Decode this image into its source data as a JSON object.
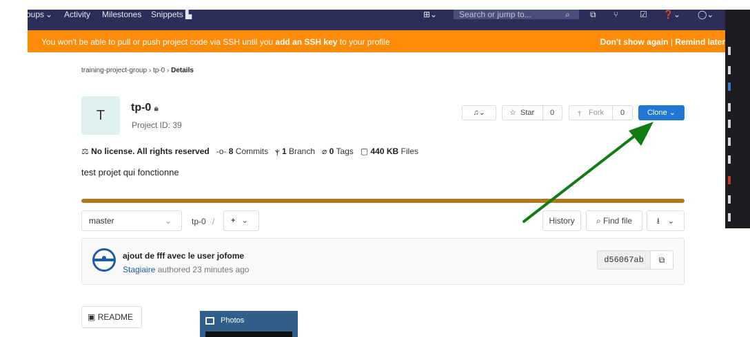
{
  "navbar": {
    "items": [
      "oups",
      "Activity",
      "Milestones",
      "Snippets"
    ],
    "search_placeholder": "Search or jump to..."
  },
  "alert": {
    "message_pre": "You won't be able to pull or push project code via SSH until you ",
    "message_bold": "add an SSH key",
    "message_post": " to your profile",
    "dont_show": "Don't show again",
    "separator": "|",
    "remind_later": "Remind later"
  },
  "breadcrumb": {
    "group": "training-project-group",
    "project": "tp-0",
    "current": "Details",
    "separator": "›"
  },
  "project": {
    "avatar_letter": "T",
    "name": "tp-0",
    "id_label": "Project ID: 39",
    "description": "test projet qui fonctionne"
  },
  "actions": {
    "star_label": "Star",
    "star_count": "0",
    "fork_label": "Fork",
    "fork_count": "0",
    "clone_label": "Clone"
  },
  "stats": {
    "license": "No license. All rights reserved",
    "commits_count": "8",
    "commits_label": "Commits",
    "branch_count": "1",
    "branch_label": "Branch",
    "tags_count": "0",
    "tags_label": "Tags",
    "files_size": "440 KB",
    "files_label": "Files"
  },
  "filebar": {
    "branch": "master",
    "path": "tp-0",
    "path_sep": "/",
    "add_label": "+",
    "history_label": "History",
    "find_file_label": "Find file"
  },
  "commit": {
    "message": "ajout de fff avec le user jofome",
    "author": "Stagiaire",
    "meta": "authored 23 minutes ago",
    "sha": "d56067ab"
  },
  "readme_label": "README",
  "photos_title": "Photos",
  "colors": {
    "navbar": "#2b2e59",
    "alert": "#fc8b08",
    "clone_button": "#1f78d1",
    "progress": "#b5771e",
    "annotation_arrow": "#0f7d13"
  },
  "icons": [
    "plus-square-icon",
    "search-icon",
    "todo-icon",
    "merge-request-icon",
    "issues-icon",
    "help-icon",
    "user-avatar-icon",
    "lock-icon",
    "bell-icon",
    "star-icon",
    "fork-icon",
    "license-icon",
    "commit-icon",
    "branch-icon",
    "tag-icon",
    "file-icon",
    "copy-icon",
    "download-icon",
    "readme-icon",
    "photos-icon"
  ]
}
